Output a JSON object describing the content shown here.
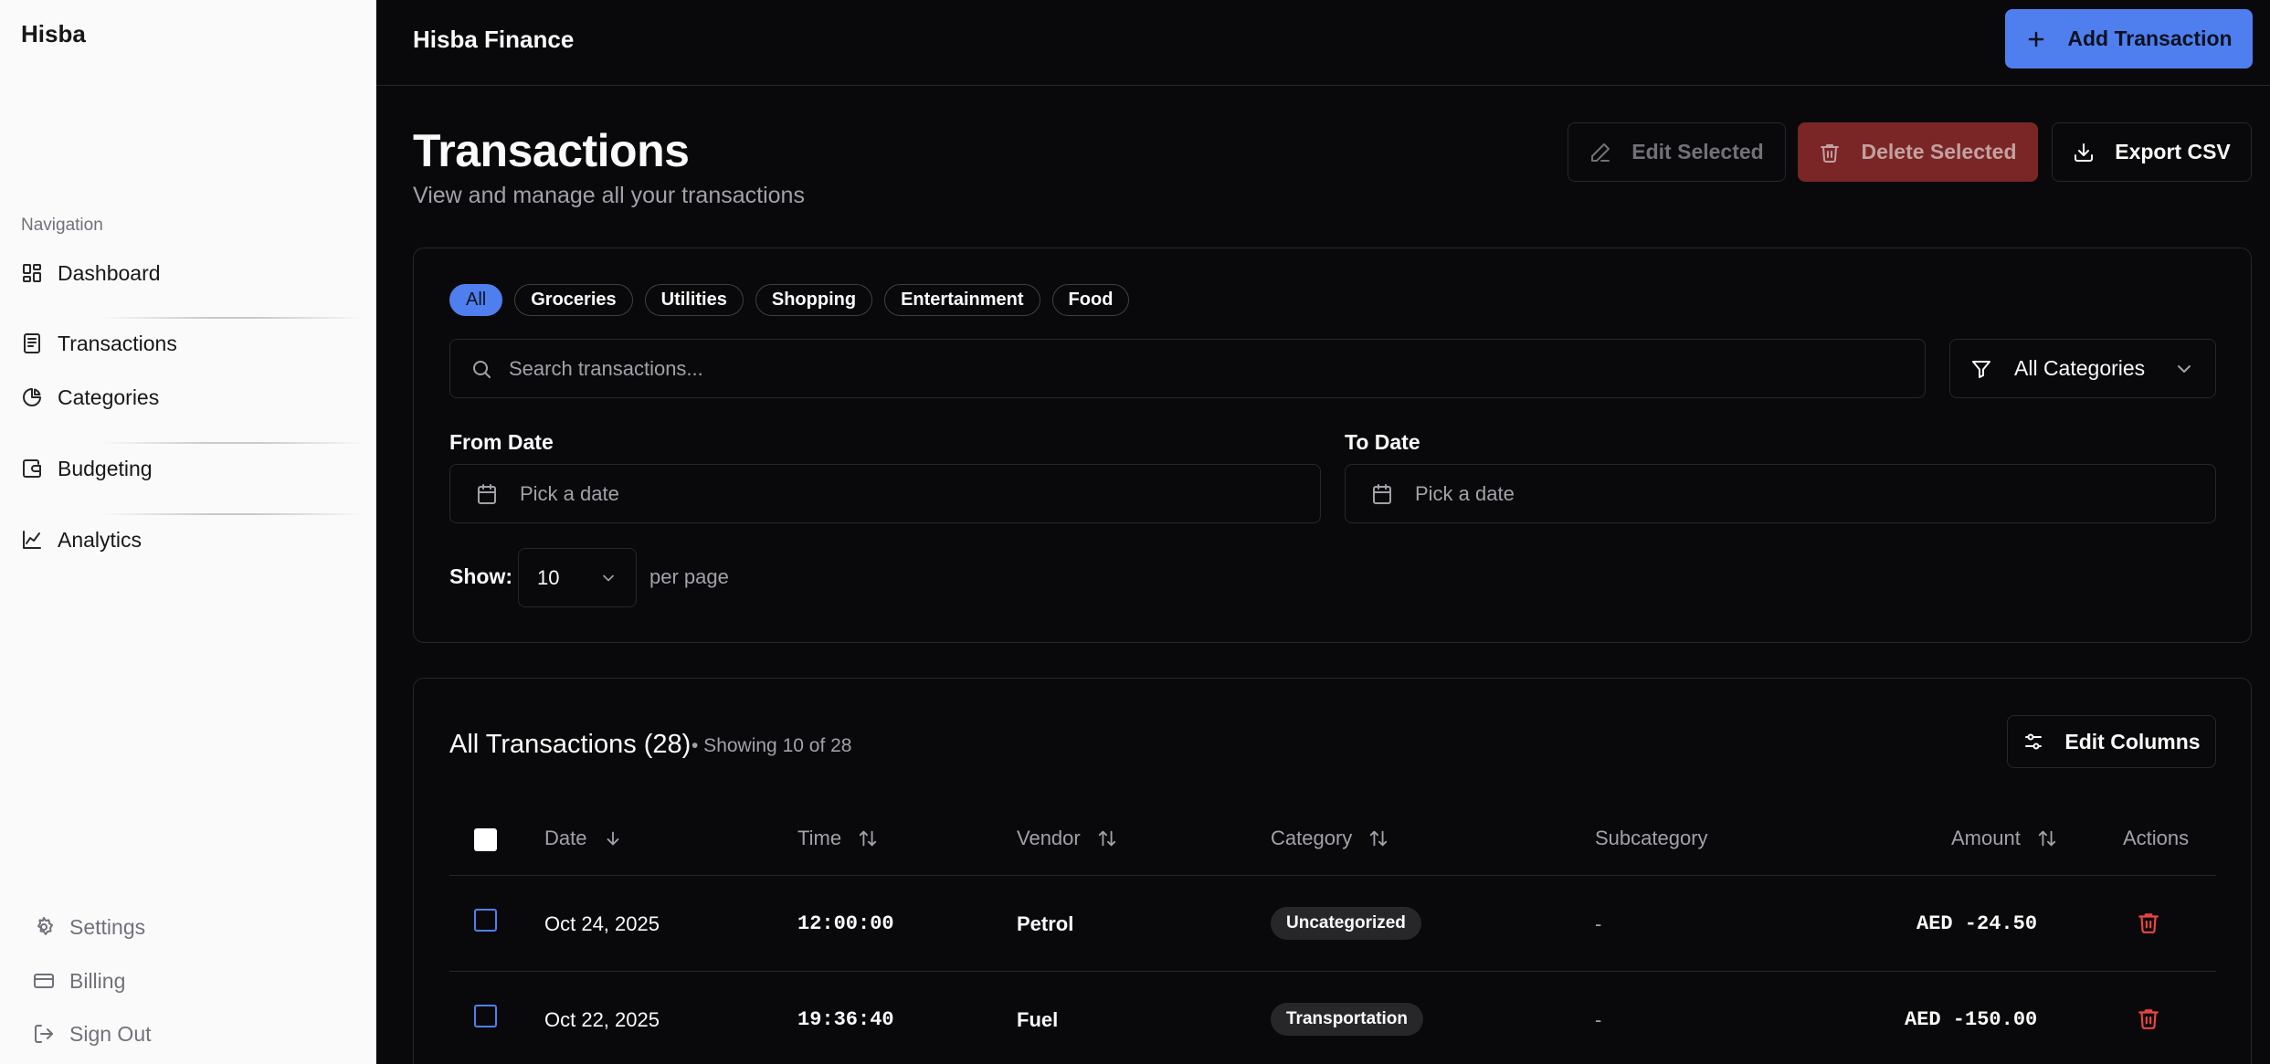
{
  "sidebar": {
    "brand": "Hisba",
    "nav_heading": "Navigation",
    "items": [
      {
        "label": "Dashboard",
        "icon": "dashboard-icon"
      },
      {
        "label": "Transactions",
        "icon": "file-text-icon"
      },
      {
        "label": "Categories",
        "icon": "pie-chart-icon"
      },
      {
        "label": "Budgeting",
        "icon": "wallet-icon"
      },
      {
        "label": "Analytics",
        "icon": "line-chart-icon"
      }
    ],
    "footer": [
      {
        "label": "Settings",
        "icon": "gear-icon"
      },
      {
        "label": "Billing",
        "icon": "credit-card-icon"
      },
      {
        "label": "Sign Out",
        "icon": "sign-out-icon"
      }
    ]
  },
  "header": {
    "app_title": "Hisba Finance",
    "add_button": "Add Transaction"
  },
  "page": {
    "title": "Transactions",
    "subtitle": "View and manage all your transactions",
    "edit_selected": "Edit Selected",
    "delete_selected": "Delete Selected",
    "export_csv": "Export CSV"
  },
  "filters": {
    "chips": [
      "All",
      "Groceries",
      "Utilities",
      "Shopping",
      "Entertainment",
      "Food"
    ],
    "active_chip": "All",
    "search_placeholder": "Search transactions...",
    "category_select": "All Categories",
    "from_label": "From Date",
    "to_label": "To Date",
    "date_placeholder": "Pick a date",
    "show_label": "Show:",
    "per_page_value": "10",
    "per_page_label": "per page"
  },
  "table": {
    "title": "All Transactions (28)",
    "subtitle": "• Showing 10 of 28",
    "edit_columns": "Edit Columns",
    "columns": {
      "date": "Date",
      "time": "Time",
      "vendor": "Vendor",
      "category": "Category",
      "subcategory": "Subcategory",
      "amount": "Amount",
      "actions": "Actions"
    },
    "rows": [
      {
        "date": "Oct 24, 2025",
        "time": "12:00:00",
        "vendor": "Petrol",
        "category": "Uncategorized",
        "subcategory": "-",
        "amount": "AED -24.50"
      },
      {
        "date": "Oct 22, 2025",
        "time": "19:36:40",
        "vendor": "Fuel",
        "category": "Transportation",
        "subcategory": "-",
        "amount": "AED -150.00"
      }
    ]
  },
  "colors": {
    "accent": "#4f7fef",
    "danger": "#ef4444",
    "background": "#09090b",
    "sidebar_bg": "#fafafa"
  }
}
